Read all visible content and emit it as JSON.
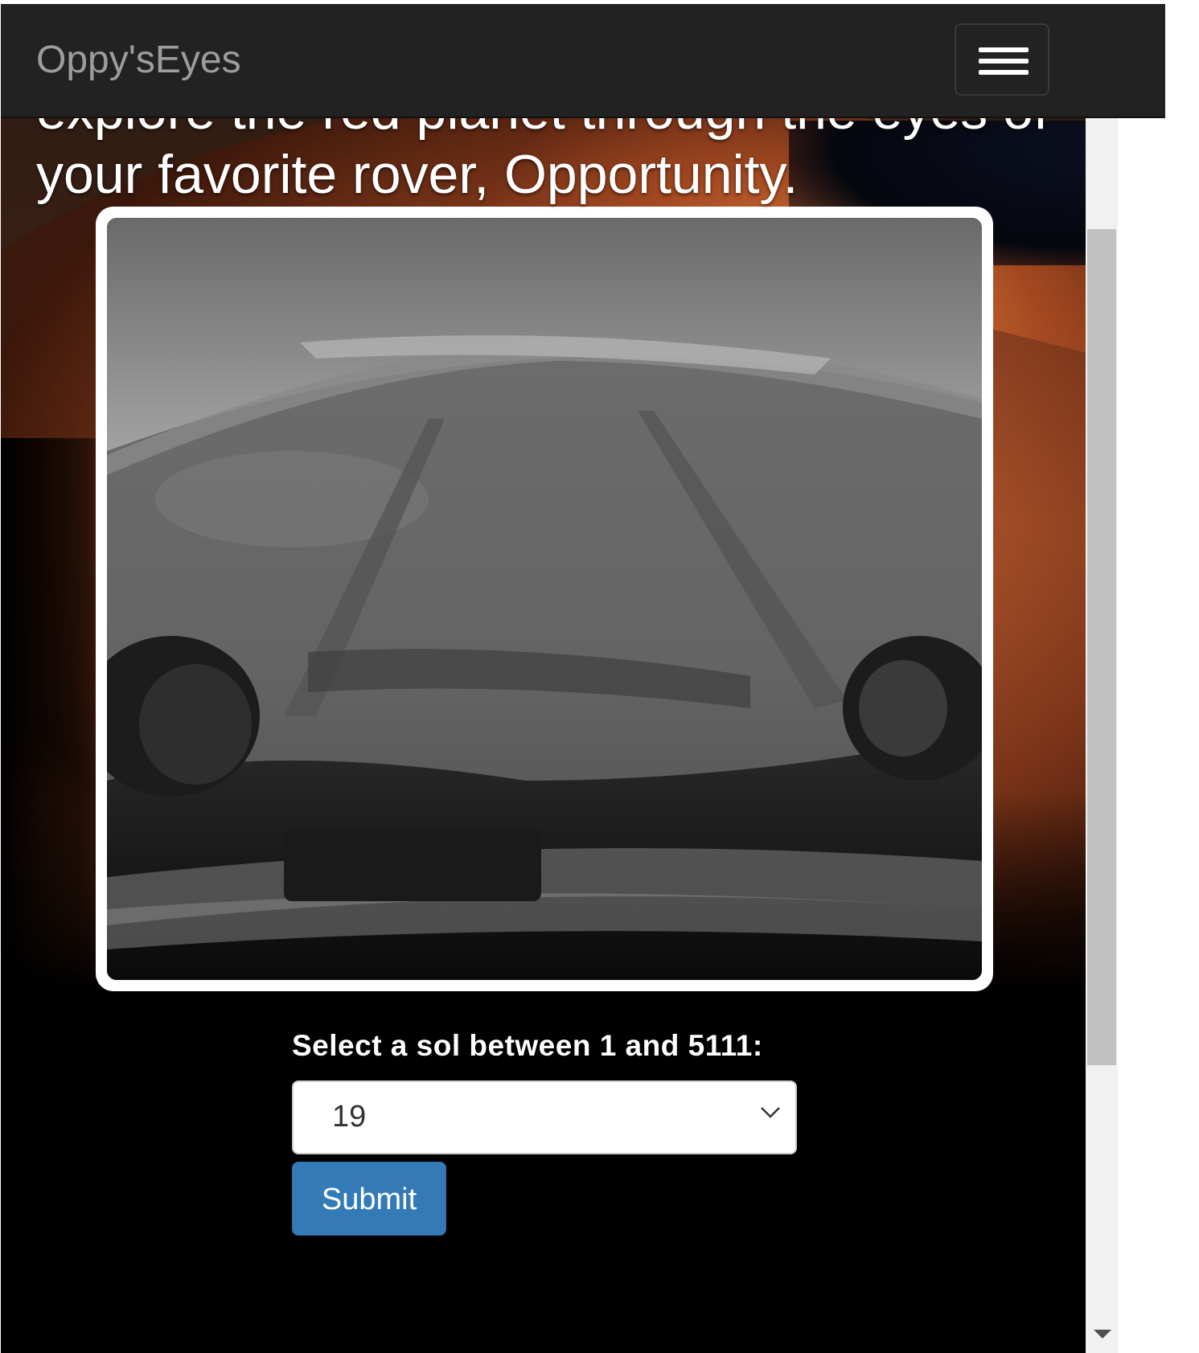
{
  "navbar": {
    "brand": "Oppy'sEyes",
    "menu_icon": "hamburger-menu-icon"
  },
  "hero": {
    "tagline_line1": "explore the red planet through the eyes of",
    "tagline_line2": "your favorite rover, Opportunity."
  },
  "photo": {
    "description_icon": "rover-photo"
  },
  "form": {
    "label": "Select a sol between 1 and 5111:",
    "selected_sol": "19",
    "submit_label": "Submit"
  },
  "colors": {
    "navbar_bg": "#222222",
    "brand_text": "#9d9d9d",
    "button_bg": "#337ab7"
  }
}
